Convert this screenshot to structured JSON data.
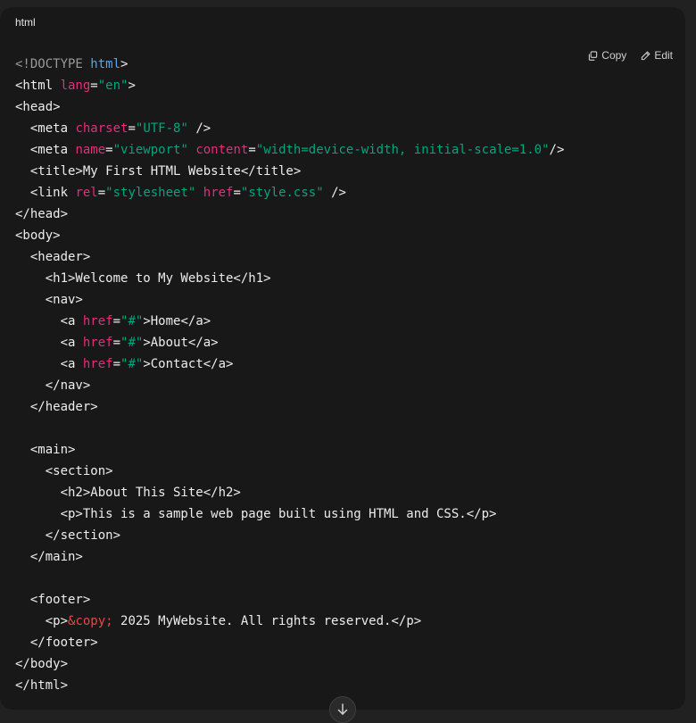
{
  "code_block": {
    "language": "html",
    "copy_label": "Copy",
    "edit_label": "Edit",
    "colors": {
      "background": "#181818",
      "plain": "#ececec",
      "doctype": "#9a9a9a",
      "keyword": "#58a6e8",
      "attribute": "#df3079",
      "string": "#00a67d",
      "entity": "#ef4444"
    },
    "lines": [
      [
        [
          "doctype",
          "<!DOCTYPE "
        ],
        [
          "kw",
          "html"
        ],
        [
          "plain",
          ">"
        ]
      ],
      [
        [
          "plain",
          "<html "
        ],
        [
          "attr",
          "lang"
        ],
        [
          "plain",
          "="
        ],
        [
          "str",
          "\"en\""
        ],
        [
          "plain",
          ">"
        ]
      ],
      [
        [
          "plain",
          "<head>"
        ]
      ],
      [
        [
          "plain",
          "  <meta "
        ],
        [
          "attr",
          "charset"
        ],
        [
          "plain",
          "="
        ],
        [
          "str",
          "\"UTF-8\""
        ],
        [
          "plain",
          " />"
        ]
      ],
      [
        [
          "plain",
          "  <meta "
        ],
        [
          "attr",
          "name"
        ],
        [
          "plain",
          "="
        ],
        [
          "str",
          "\"viewport\""
        ],
        [
          "plain",
          " "
        ],
        [
          "attr",
          "content"
        ],
        [
          "plain",
          "="
        ],
        [
          "str",
          "\"width=device-width, initial-scale=1.0\""
        ],
        [
          "plain",
          "/>"
        ]
      ],
      [
        [
          "plain",
          "  <title>My First HTML Website</title>"
        ]
      ],
      [
        [
          "plain",
          "  <link "
        ],
        [
          "attr",
          "rel"
        ],
        [
          "plain",
          "="
        ],
        [
          "str",
          "\"stylesheet\""
        ],
        [
          "plain",
          " "
        ],
        [
          "attr",
          "href"
        ],
        [
          "plain",
          "="
        ],
        [
          "str",
          "\"style.css\""
        ],
        [
          "plain",
          " />"
        ]
      ],
      [
        [
          "plain",
          "</head>"
        ]
      ],
      [
        [
          "plain",
          "<body>"
        ]
      ],
      [
        [
          "plain",
          "  <header>"
        ]
      ],
      [
        [
          "plain",
          "    <h1>Welcome to My Website</h1>"
        ]
      ],
      [
        [
          "plain",
          "    <nav>"
        ]
      ],
      [
        [
          "plain",
          "      <a "
        ],
        [
          "attr",
          "href"
        ],
        [
          "plain",
          "="
        ],
        [
          "str",
          "\"#\""
        ],
        [
          "plain",
          ">Home</a>"
        ]
      ],
      [
        [
          "plain",
          "      <a "
        ],
        [
          "attr",
          "href"
        ],
        [
          "plain",
          "="
        ],
        [
          "str",
          "\"#\""
        ],
        [
          "plain",
          ">About</a>"
        ]
      ],
      [
        [
          "plain",
          "      <a "
        ],
        [
          "attr",
          "href"
        ],
        [
          "plain",
          "="
        ],
        [
          "str",
          "\"#\""
        ],
        [
          "plain",
          ">Contact</a>"
        ]
      ],
      [
        [
          "plain",
          "    </nav>"
        ]
      ],
      [
        [
          "plain",
          "  </header>"
        ]
      ],
      [],
      [
        [
          "plain",
          "  <main>"
        ]
      ],
      [
        [
          "plain",
          "    <section>"
        ]
      ],
      [
        [
          "plain",
          "      <h2>About This Site</h2>"
        ]
      ],
      [
        [
          "plain",
          "      <p>This is a sample web page built using HTML and CSS.</p>"
        ]
      ],
      [
        [
          "plain",
          "    </section>"
        ]
      ],
      [
        [
          "plain",
          "  </main>"
        ]
      ],
      [],
      [
        [
          "plain",
          "  <footer>"
        ]
      ],
      [
        [
          "plain",
          "    <p>"
        ],
        [
          "ent",
          "&copy;"
        ],
        [
          "plain",
          " 2025 MyWebsite. All rights reserved.</p>"
        ]
      ],
      [
        [
          "plain",
          "  </footer>"
        ]
      ],
      [
        [
          "plain",
          "</body>"
        ]
      ],
      [
        [
          "plain",
          "</html>"
        ]
      ]
    ]
  },
  "scroll_button": {
    "icon": "arrow-down-icon"
  }
}
